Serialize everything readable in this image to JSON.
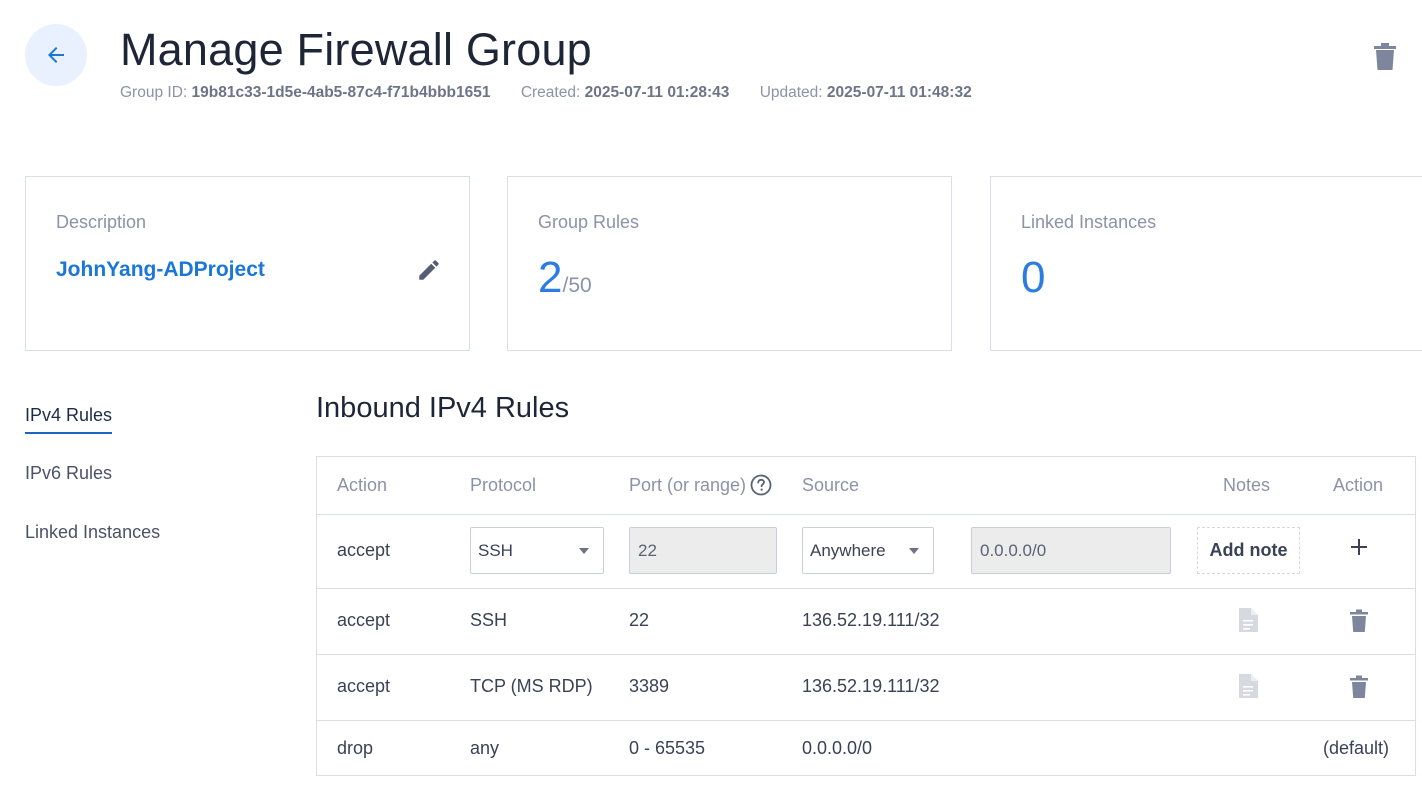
{
  "header": {
    "title": "Manage Firewall Group",
    "group_id_label": "Group ID:",
    "group_id": "19b81c33-1d5e-4ab5-87c4-f71b4bbb1651",
    "created_label": "Created:",
    "created": "2025-07-11 01:28:43",
    "updated_label": "Updated:",
    "updated": "2025-07-11 01:48:32",
    "back_icon": "arrow-left-icon",
    "delete_icon": "trash-icon"
  },
  "cards": {
    "description": {
      "label": "Description",
      "value": "JohnYang-ADProject",
      "edit_icon": "pencil-icon"
    },
    "group_rules": {
      "label": "Group Rules",
      "count": "2",
      "max": "/50"
    },
    "linked_instances": {
      "label": "Linked Instances",
      "count": "0"
    }
  },
  "side_nav": {
    "items": [
      {
        "label": "IPv4 Rules",
        "active": true
      },
      {
        "label": "IPv6 Rules",
        "active": false
      },
      {
        "label": "Linked Instances",
        "active": false
      }
    ]
  },
  "section": {
    "title": "Inbound IPv4 Rules"
  },
  "table": {
    "headers": {
      "action": "Action",
      "protocol": "Protocol",
      "port": "Port (or range)",
      "source": "Source",
      "notes": "Notes",
      "action2": "Action"
    },
    "new_rule": {
      "action": "accept",
      "protocol": "SSH",
      "port": "22",
      "source_type": "Anywhere",
      "source_value": "0.0.0.0/0",
      "add_note_label": "Add note",
      "add_icon": "plus-icon"
    },
    "rows": [
      {
        "action": "accept",
        "protocol": "SSH",
        "port": "22",
        "source": "136.52.19.111/32"
      },
      {
        "action": "accept",
        "protocol": "TCP (MS RDP)",
        "port": "3389",
        "source": "136.52.19.111/32"
      }
    ],
    "default_row": {
      "action": "drop",
      "protocol": "any",
      "port": "0 - 65535",
      "source": "0.0.0.0/0",
      "note": "(default)"
    }
  },
  "colors": {
    "accent": "#1a77d8",
    "muted": "#8b93a7",
    "border": "#d9dee7"
  }
}
